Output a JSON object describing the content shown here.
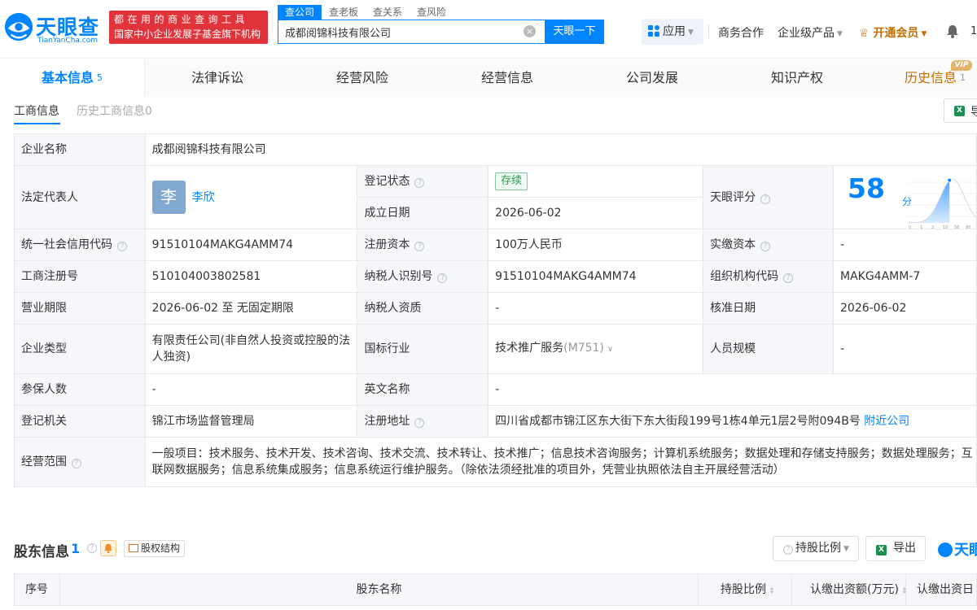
{
  "brand": {
    "name": "天眼查",
    "domain": "TianYanCha.com",
    "slogan_line1": "都在用的商业查询工具",
    "slogan_line2": "国家中小企业发展子基金旗下机构"
  },
  "search": {
    "tabs": [
      "查公司",
      "查老板",
      "查关系",
      "查风险"
    ],
    "active_tab": 0,
    "value": "成都阅锦科技有限公司",
    "button": "天眼一下"
  },
  "topnav": {
    "apps": "应用",
    "business": "商务合作",
    "enterprise": "企业级产品",
    "vip": "开通会员",
    "num": "1"
  },
  "main_tabs": {
    "basic": "基本信息",
    "basic_count": "5",
    "legal": "法律诉讼",
    "risk": "经营风险",
    "operation": "经营信息",
    "development": "公司发展",
    "ip": "知识产权",
    "history": "历史信息",
    "history_count": "1",
    "vip_badge": "VIP"
  },
  "sub_tabs": {
    "active": "工商信息",
    "inactive": "历史工商信息0",
    "export_mini": "导"
  },
  "info": {
    "company_name_label": "企业名称",
    "company_name": "成都阅锦科技有限公司",
    "legal_rep_label": "法定代表人",
    "legal_rep_avatar": "李",
    "legal_rep_name": "李欣",
    "reg_status_label": "登记状态",
    "reg_status": "存续",
    "founded_label": "成立日期",
    "founded": "2026-06-02",
    "score_label": "天眼评分",
    "score": "58",
    "score_unit": "分",
    "credit_code_label": "统一社会信用代码",
    "credit_code": "91510104MAKG4AMM74",
    "reg_capital_label": "注册资本",
    "reg_capital": "100万人民币",
    "paid_capital_label": "实缴资本",
    "paid_capital": "-",
    "reg_no_label": "工商注册号",
    "reg_no": "510104003802581",
    "taxpayer_id_label": "纳税人识别号",
    "taxpayer_id": "91510104MAKG4AMM74",
    "org_code_label": "组织机构代码",
    "org_code": "MAKG4AMM-7",
    "term_label": "营业期限",
    "term": "2026-06-02 至 无固定期限",
    "taxpayer_qual_label": "纳税人资质",
    "taxpayer_qual": "-",
    "approval_date_label": "核准日期",
    "approval_date": "2026-06-02",
    "type_label": "企业类型",
    "type": "有限责任公司(非自然人投资或控股的法人独资)",
    "industry_label": "国标行业",
    "industry": "技术推广服务",
    "industry_code": "(M751)",
    "staff_label": "人员规模",
    "staff": "-",
    "insured_label": "参保人数",
    "insured": "-",
    "en_name_label": "英文名称",
    "en_name": "-",
    "authority_label": "登记机关",
    "authority": "锦江市场监督管理局",
    "address_label": "注册地址",
    "address": "四川省成都市锦江区东大街下东大街段199号1栋4单元1层2号附094B号",
    "nearby": "附近公司",
    "scope_label": "经营范围",
    "scope": "一般项目：技术服务、技术开发、技术咨询、技术交流、技术转让、技术推广；信息技术咨询服务；计算机系统服务；数据处理和存储支持服务；数据处理服务；互联网数据服务；信息系统集成服务；信息系统运行维护服务。（除依法须经批准的项目外，凭营业执照依法自主开展经营活动）"
  },
  "score_chart": {
    "ticks": [
      "0",
      "1",
      "3",
      "10",
      "58",
      "80",
      "97"
    ],
    "score_fraction": 0.58
  },
  "shareholders": {
    "title": "股东信息",
    "count": "1",
    "structure": "股权结构",
    "ratio_btn": "持股比例",
    "export": "导出",
    "brand_mini": "天眼",
    "columns": [
      "序号",
      "股东名称",
      "持股比例",
      "认缴出资额(万元)",
      "认缴出资日"
    ]
  },
  "colors": {
    "brand_blue": "#0084ff",
    "slogan_red": "#e0343a",
    "vip_gold": "#c36f00",
    "status_green": "#2b9a4f"
  }
}
